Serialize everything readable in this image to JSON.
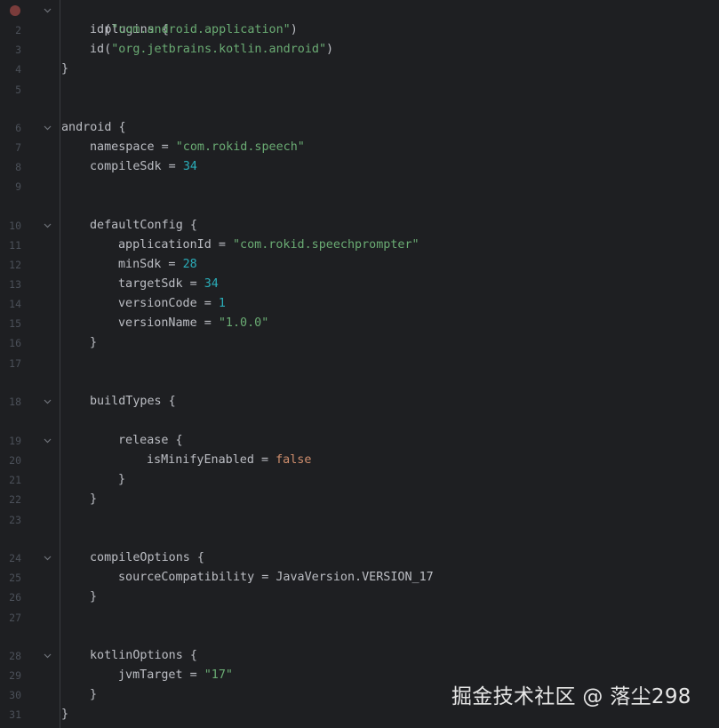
{
  "editor": {
    "lines": [
      {
        "no": "",
        "parts": [
          {
            "t": "plugins {",
            "c": ""
          }
        ]
      },
      {
        "no": "2",
        "parts": [
          {
            "t": "id(",
            "c": ""
          },
          {
            "t": "\"com.android.application\"",
            "c": "str"
          },
          {
            "t": ")",
            "c": ""
          }
        ]
      },
      {
        "no": "3",
        "parts": [
          {
            "t": "id(",
            "c": ""
          },
          {
            "t": "\"org.jetbrains.kotlin.android\"",
            "c": "str"
          },
          {
            "t": ")",
            "c": ""
          }
        ]
      },
      {
        "no": "4",
        "parts": [
          {
            "t": "}",
            "c": ""
          }
        ]
      },
      {
        "no": "5",
        "parts": []
      },
      {
        "no": "6",
        "parts": [
          {
            "t": "android {",
            "c": ""
          }
        ]
      },
      {
        "no": "7",
        "parts": [
          {
            "t": "namespace = ",
            "c": ""
          },
          {
            "t": "\"com.rokid.speech\"",
            "c": "str"
          }
        ]
      },
      {
        "no": "8",
        "parts": [
          {
            "t": "compileSdk = ",
            "c": ""
          },
          {
            "t": "34",
            "c": "num"
          }
        ]
      },
      {
        "no": "9",
        "parts": []
      },
      {
        "no": "10",
        "parts": [
          {
            "t": "defaultConfig {",
            "c": ""
          }
        ]
      },
      {
        "no": "11",
        "parts": [
          {
            "t": "applicationId = ",
            "c": ""
          },
          {
            "t": "\"com.rokid.speechprompter\"",
            "c": "str"
          }
        ]
      },
      {
        "no": "12",
        "parts": [
          {
            "t": "minSdk = ",
            "c": ""
          },
          {
            "t": "28",
            "c": "num"
          }
        ]
      },
      {
        "no": "13",
        "parts": [
          {
            "t": "targetSdk = ",
            "c": ""
          },
          {
            "t": "34",
            "c": "num"
          }
        ]
      },
      {
        "no": "14",
        "parts": [
          {
            "t": "versionCode = ",
            "c": ""
          },
          {
            "t": "1",
            "c": "num"
          }
        ]
      },
      {
        "no": "15",
        "parts": [
          {
            "t": "versionName = ",
            "c": ""
          },
          {
            "t": "\"1.0.0\"",
            "c": "str"
          }
        ]
      },
      {
        "no": "16",
        "parts": [
          {
            "t": "}",
            "c": ""
          }
        ]
      },
      {
        "no": "17",
        "parts": []
      },
      {
        "no": "18",
        "parts": [
          {
            "t": "buildTypes {",
            "c": ""
          }
        ]
      },
      {
        "no": "19",
        "parts": [
          {
            "t": "release {",
            "c": ""
          }
        ]
      },
      {
        "no": "20",
        "parts": [
          {
            "t": "isMinifyEnabled = ",
            "c": ""
          },
          {
            "t": "false",
            "c": "kw"
          }
        ]
      },
      {
        "no": "21",
        "parts": [
          {
            "t": "}",
            "c": ""
          }
        ]
      },
      {
        "no": "22",
        "parts": [
          {
            "t": "}",
            "c": ""
          }
        ]
      },
      {
        "no": "23",
        "parts": []
      },
      {
        "no": "24",
        "parts": [
          {
            "t": "compileOptions {",
            "c": ""
          }
        ]
      },
      {
        "no": "25",
        "parts": [
          {
            "t": "sourceCompatibility = JavaVersion.VERSION_17",
            "c": ""
          }
        ]
      },
      {
        "no": "26",
        "parts": [
          {
            "t": "}",
            "c": ""
          }
        ]
      },
      {
        "no": "27",
        "parts": []
      },
      {
        "no": "28",
        "parts": [
          {
            "t": "kotlinOptions {",
            "c": ""
          }
        ]
      },
      {
        "no": "29",
        "parts": [
          {
            "t": "jvmTarget = ",
            "c": ""
          },
          {
            "t": "\"17\"",
            "c": "str"
          }
        ]
      },
      {
        "no": "30",
        "parts": [
          {
            "t": "}",
            "c": ""
          }
        ]
      },
      {
        "no": "31",
        "parts": [
          {
            "t": "}",
            "c": ""
          }
        ]
      }
    ]
  },
  "watermark": "掘金技术社区 @ 落尘298",
  "colors": {
    "background": "#1e1f22",
    "string": "#6aab73",
    "number": "#2aacb8",
    "keyword": "#cf8e6d",
    "breakpoint": "#c75450"
  }
}
